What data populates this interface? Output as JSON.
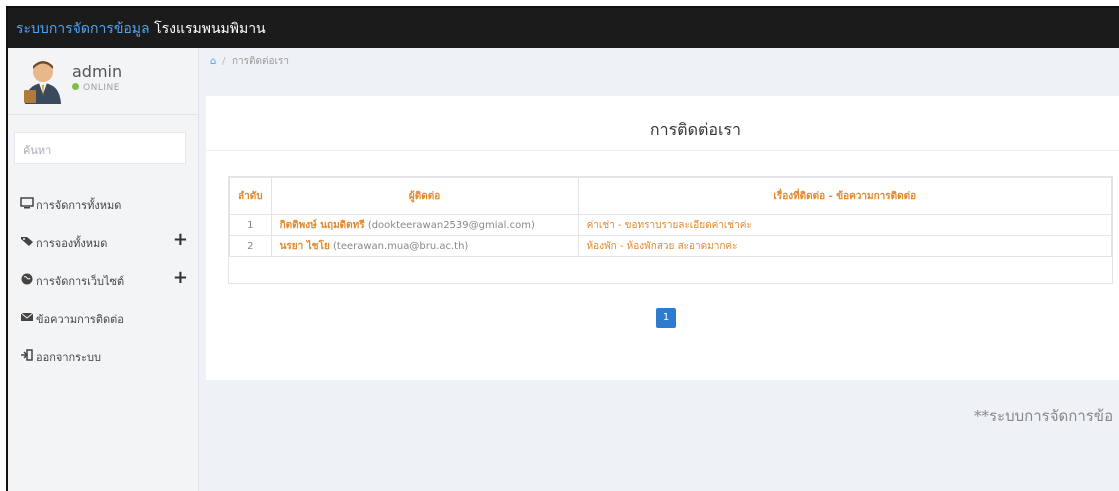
{
  "header": {
    "title_accent": "ระบบการจัดการข้อมูล",
    "title_rest": "โรงแรมพนมพิมาน"
  },
  "user": {
    "name": "admin",
    "status": "ONLINE"
  },
  "search": {
    "placeholder": "ค้นหา"
  },
  "menu": [
    {
      "label": "การจัดการทั้งหมด",
      "icon": "monitor-icon"
    },
    {
      "label": "การจองทั้งหมด",
      "icon": "tag-icon",
      "expandable": true
    },
    {
      "label": "การจัดการเว็บไซต์",
      "icon": "globe-icon",
      "expandable": true
    },
    {
      "label": "ข้อความการติดต่อ",
      "icon": "envelope-icon"
    },
    {
      "label": "ออกจากระบบ",
      "icon": "sign-out-icon"
    }
  ],
  "breadcrumb": {
    "current": "การติดต่อเรา"
  },
  "panel": {
    "title": "การติดต่อเรา"
  },
  "table": {
    "headers": [
      "ลำดับ",
      "ผู้ติดต่อ",
      "เรื่องที่ติดต่อ - ข้อความการติดต่อ"
    ],
    "rows": [
      {
        "no": "1",
        "name": "กิตติพงษ์ นฤมดิตทรี",
        "email": "(dookteerawan2539@gmial.com)",
        "message": "ค่าเช่า - ขอทราบรายละเอียดค่าเช่าค่ะ"
      },
      {
        "no": "2",
        "name": "นรยา ไชโย",
        "email": "(teerawan.mua@bru.ac.th)",
        "message": "ห้องพัก - ห้องพักสวย สะอาดมากค่ะ"
      }
    ]
  },
  "pagination": {
    "current": "1"
  },
  "footer": {
    "text": "**ระบบการจัดการข้อ"
  },
  "colors": {
    "accent": "#4fa3f7",
    "header_bg": "#1b1b1b",
    "table_text": "#e08a2c",
    "pager": "#2f7ccf"
  }
}
